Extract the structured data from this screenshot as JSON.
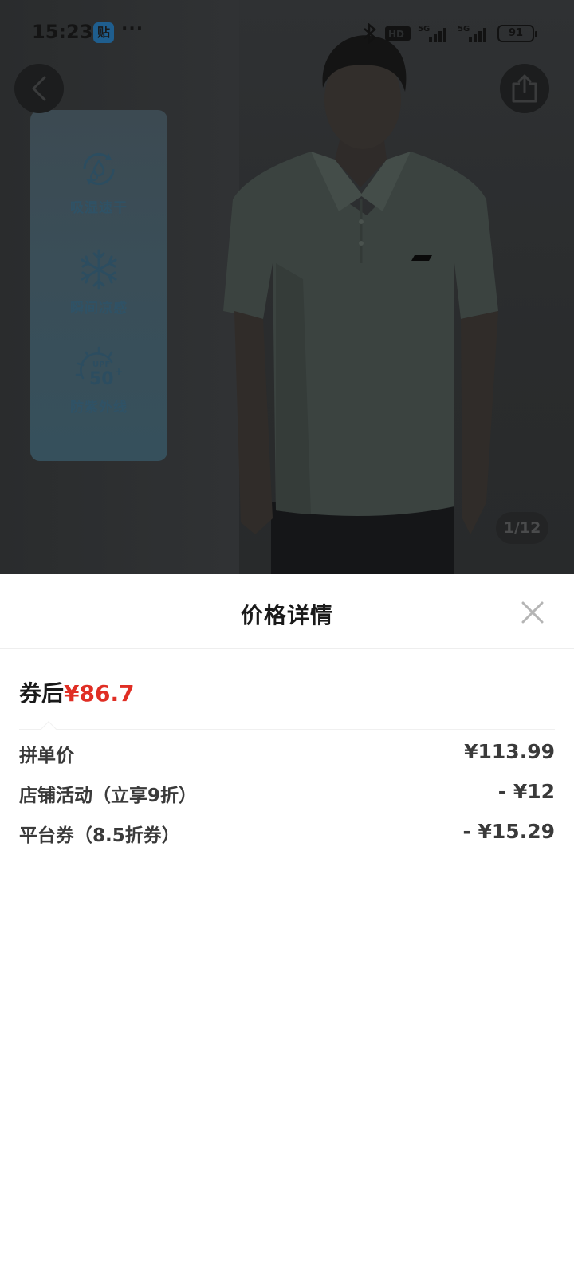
{
  "status_bar": {
    "time": "15:23",
    "app_icon_text": "贴",
    "more": "···",
    "battery": "91"
  },
  "product_image": {
    "features": [
      {
        "label": "吸湿速干",
        "icon": "moisture-drop-cycle-icon"
      },
      {
        "label": "瞬间凉感",
        "icon": "snowflake-icon"
      },
      {
        "label": "防紫外线",
        "icon": "upf50-sun-icon"
      }
    ],
    "upf_text": "UPF",
    "upf_value": "50",
    "page_counter": "1/12"
  },
  "sheet": {
    "title": "价格详情",
    "after_coupon_label": "券后",
    "after_coupon_price": "¥86.7",
    "rows": [
      {
        "label": "拼单价",
        "value": "¥113.99"
      },
      {
        "label": "店铺活动（立享9折）",
        "value": "- ¥12"
      },
      {
        "label": "平台券（8.5折券）",
        "value": "- ¥15.29"
      }
    ]
  },
  "colors": {
    "accent_red": "#e02e24",
    "overlay_dark": "#2a2c2d"
  }
}
